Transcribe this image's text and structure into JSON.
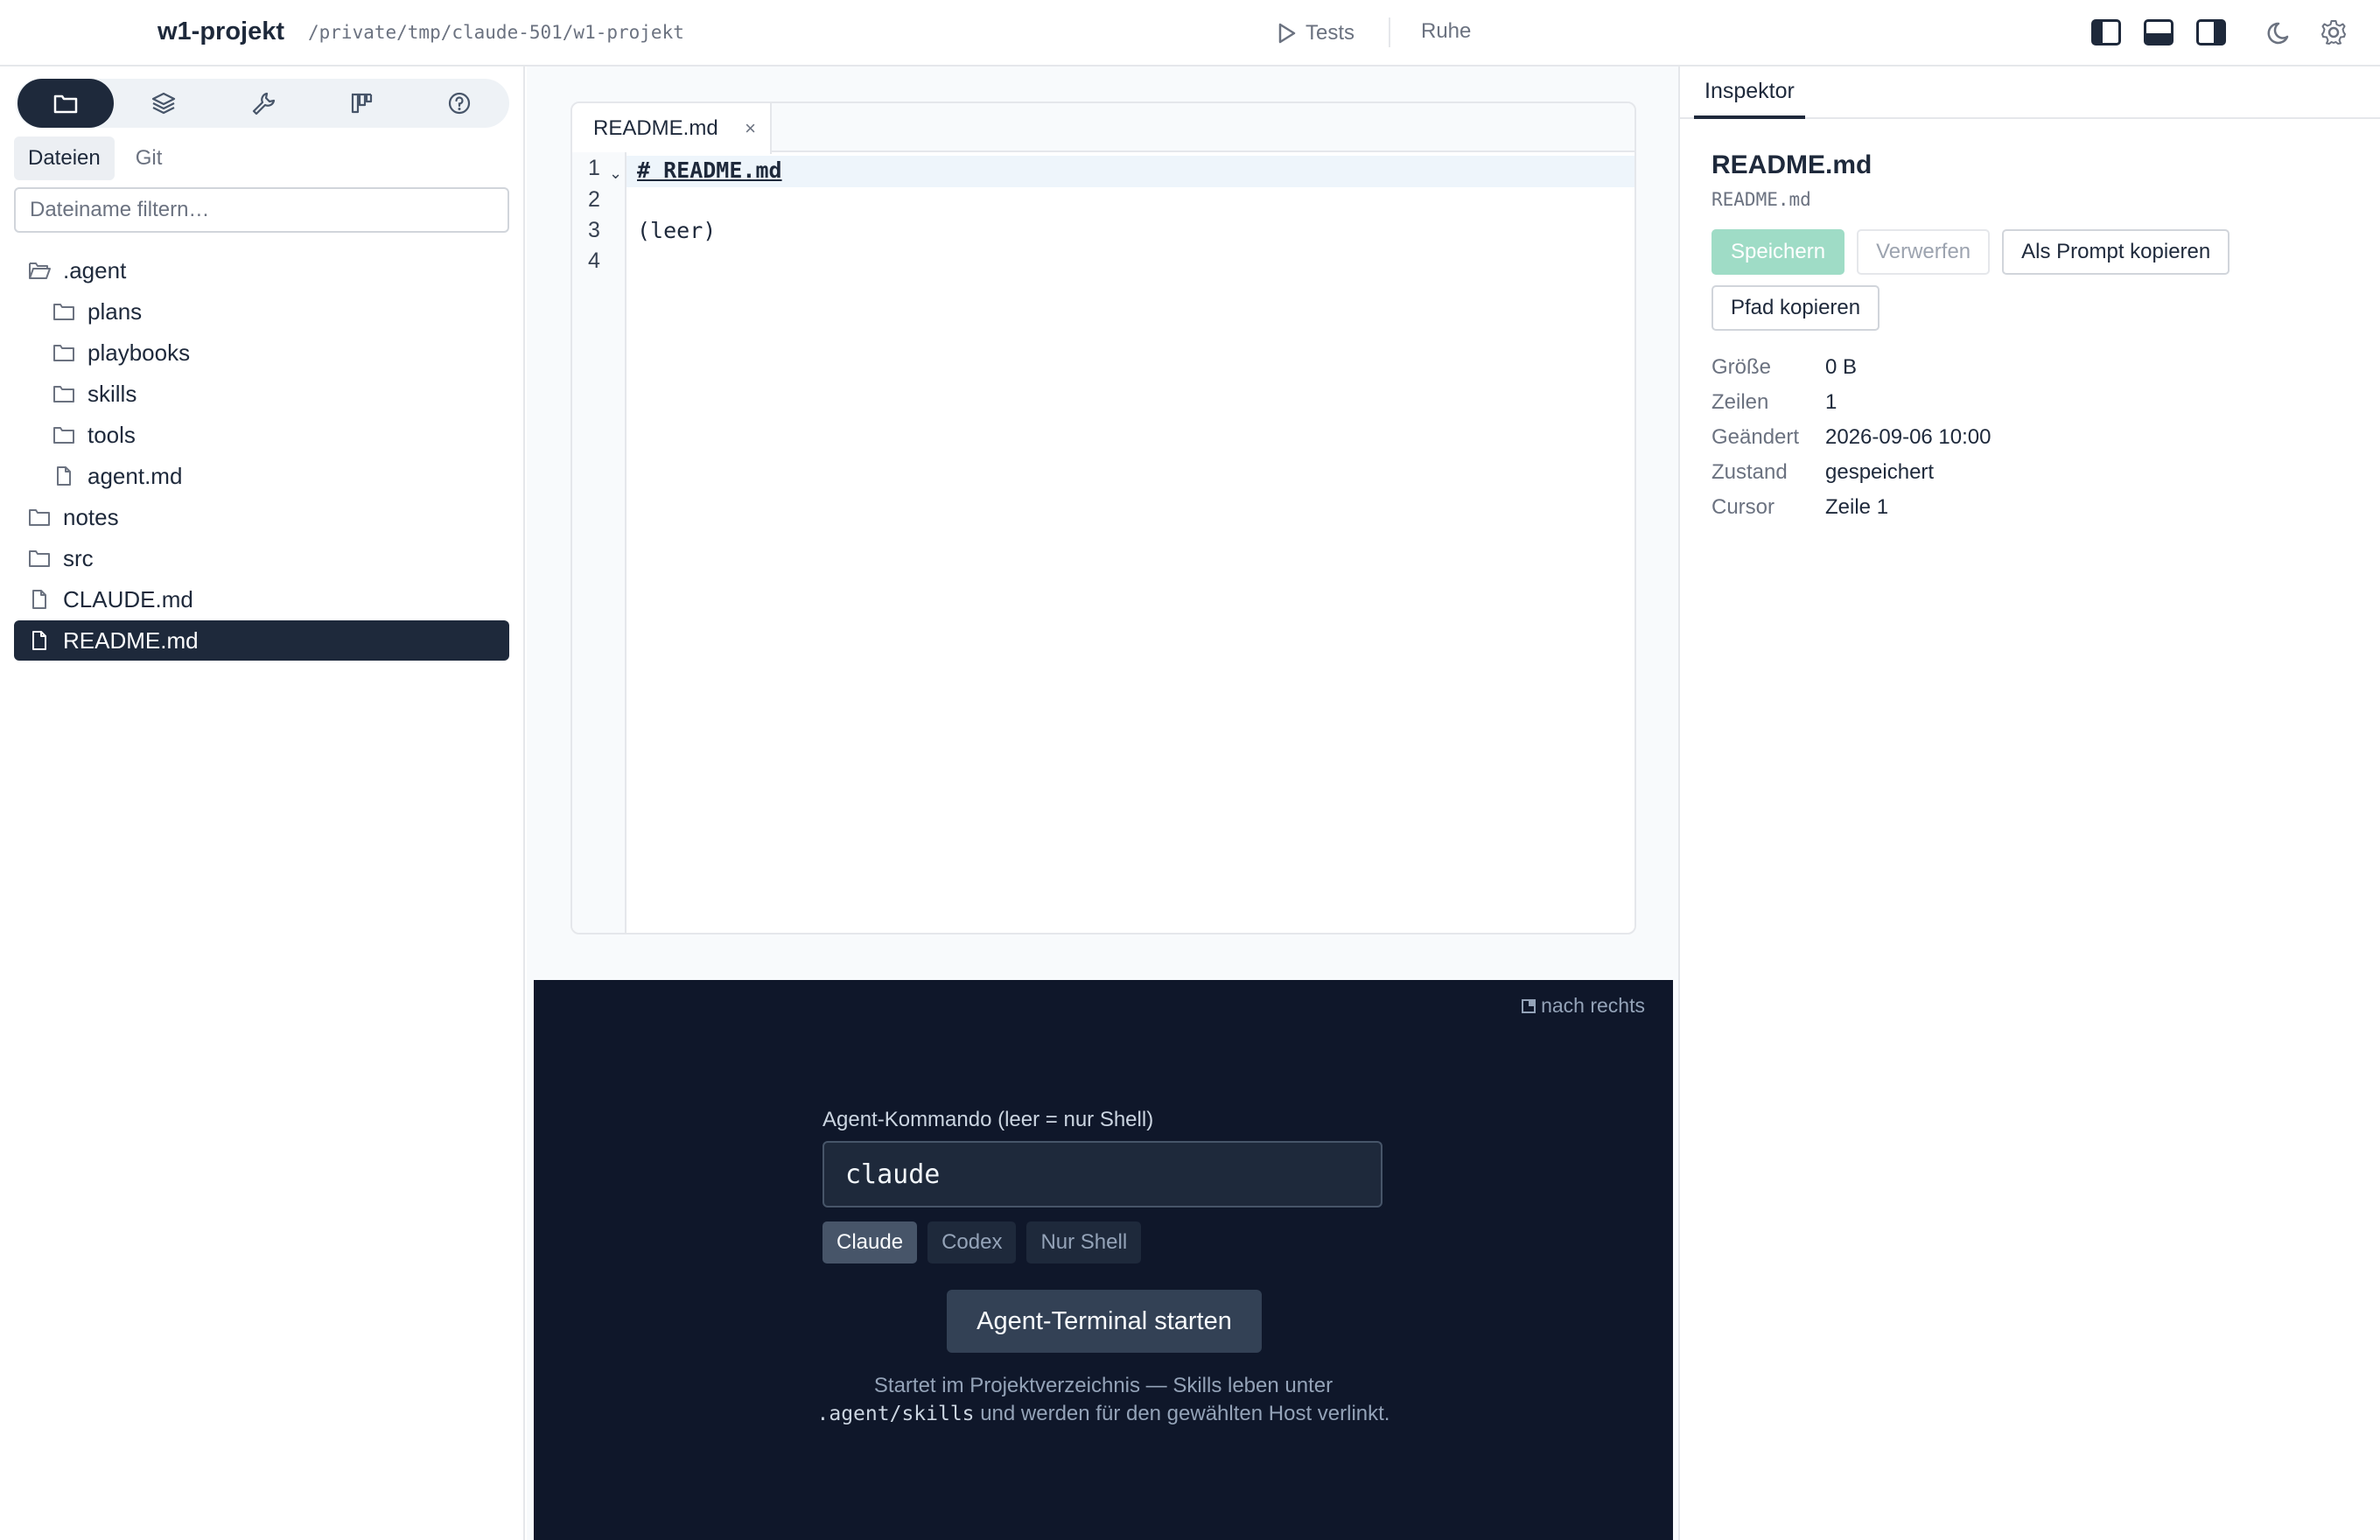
{
  "header": {
    "app_title": "w1-projekt",
    "path": "/private/tmp/claude-501/w1-projekt",
    "tests_label": "Tests",
    "status": "Ruhe"
  },
  "sidebar": {
    "icon_tabs": [
      "folder-icon",
      "layers-icon",
      "wrench-icon",
      "kanban-icon",
      "help-icon"
    ],
    "sub_tabs": [
      "Dateien",
      "Git"
    ],
    "filter_placeholder": "Dateiname filtern…",
    "tree": [
      {
        "name": ".agent",
        "type": "folder-open",
        "level": 0
      },
      {
        "name": "plans",
        "type": "folder",
        "level": 1
      },
      {
        "name": "playbooks",
        "type": "folder",
        "level": 1
      },
      {
        "name": "skills",
        "type": "folder",
        "level": 1
      },
      {
        "name": "tools",
        "type": "folder",
        "level": 1
      },
      {
        "name": "agent.md",
        "type": "file",
        "level": 1
      },
      {
        "name": "notes",
        "type": "folder",
        "level": 0
      },
      {
        "name": "src",
        "type": "folder",
        "level": 0
      },
      {
        "name": "CLAUDE.md",
        "type": "file",
        "level": 0
      },
      {
        "name": "README.md",
        "type": "file",
        "level": 0,
        "selected": true
      }
    ]
  },
  "editor": {
    "tab_label": "README.md",
    "close_glyph": "×",
    "line_numbers": [
      "1",
      "2",
      "3",
      "4"
    ],
    "lines": [
      "# README.md",
      "",
      "(leer)",
      ""
    ]
  },
  "terminal": {
    "dock_label": "nach rechts",
    "agent_label": "Agent-Kommando (leer = nur Shell)",
    "agent_value": "claude",
    "presets": [
      "Claude",
      "Codex",
      "Nur Shell"
    ],
    "start_label": "Agent-Terminal starten",
    "hint_before": "Startet im Projektverzeichnis — Skills leben unter",
    "hint_code": ".agent/skills",
    "hint_after": "und werden für den gewählten Host verlinkt."
  },
  "inspector": {
    "tab": "Inspektor",
    "title": "README.md",
    "subtitle": "README.md",
    "buttons": {
      "save": "Speichern",
      "discard": "Verwerfen",
      "copy_prompt": "Als Prompt kopieren",
      "copy_path": "Pfad kopieren"
    },
    "meta": [
      {
        "key": "Größe",
        "value": "0 B"
      },
      {
        "key": "Zeilen",
        "value": "1"
      },
      {
        "key": "Geändert",
        "value": "2026-09-06 10:00"
      },
      {
        "key": "Zustand",
        "value": "gespeichert"
      },
      {
        "key": "Cursor",
        "value": "Zeile 1"
      }
    ]
  },
  "colors": {
    "dark": "#1e293b",
    "terminal_bg": "#0f172a",
    "save_accent": "#9fdcc6",
    "active_line": "#eef5fb"
  }
}
